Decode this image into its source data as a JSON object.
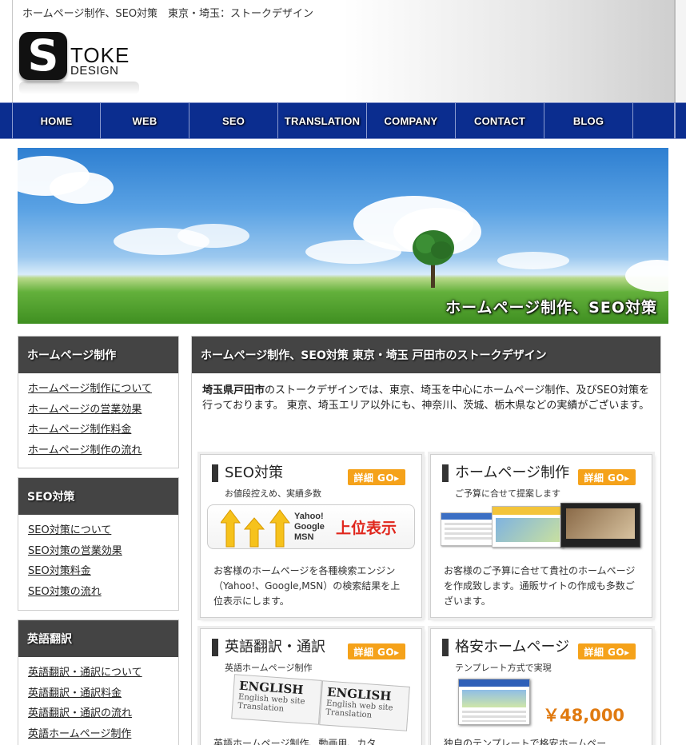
{
  "header": {
    "tagline": "ホームページ制作、SEO対策　東京・埼玉：ストークデザイン",
    "logo_letter": "S",
    "logo_word": "TOKE",
    "logo_sub": "DESIGN"
  },
  "nav": {
    "items": [
      "HOME",
      "WEB",
      "SEO",
      "TRANSLATION",
      "COMPANY",
      "CONTACT",
      "BLOG"
    ]
  },
  "hero": {
    "caption": "ホームページ制作、SEO対策"
  },
  "sidebar": {
    "sections": [
      {
        "title": "ホームページ制作",
        "links": [
          "ホームページ制作について",
          "ホームページの営業効果",
          "ホームページ制作料金",
          "ホームページ制作の流れ"
        ]
      },
      {
        "title": "SEO対策",
        "links": [
          "SEO対策について",
          "SEO対策の営業効果",
          "SEO対策料金",
          "SEO対策の流れ"
        ]
      },
      {
        "title": "英語翻訳",
        "links": [
          "英語翻訳・通訳について",
          "英語翻訳・通訳料金",
          "英語翻訳・通訳の流れ",
          "英語ホームページ制作"
        ]
      }
    ]
  },
  "main": {
    "heading": "ホームページ制作、SEO対策 東京・埼玉 戸田市のストークデザイン",
    "intro_bold": "埼玉県戸田市",
    "intro_rest": "のストークデザインでは、東京、埼玉を中心にホームページ制作、及びSEO対策を行っております。 東京、埼玉エリア以外にも、神奈川、茨城、栃木県などの実績がございます。",
    "cards": [
      {
        "title": "SEO対策",
        "subtitle": "お値段控えめ、実績多数",
        "go": "詳細 GO▸",
        "engines": "Yahoo! Google MSN",
        "badge": "上位表示",
        "desc": "お客様のホームページを各種検索エンジン（Yahoo!、Google,MSN）の検索結果を上位表示にします。"
      },
      {
        "title": "ホームページ制作",
        "subtitle": "ご予算に合せて提案します",
        "go": "詳細 GO▸",
        "desc": "お客様のご予算に合せて貴社のホームページを作成致します。通販サイトの作成も多数ございます。"
      },
      {
        "title": "英語翻訳・通訳",
        "subtitle": "英語ホームページ制作",
        "go": "詳細 GO▸",
        "sample_title": "ENGLISH",
        "sample_line1": "English web site",
        "sample_line2": "Translation",
        "desc": "英語ホームページ制作、動画用、カタ"
      },
      {
        "title": "格安ホームページ",
        "subtitle": "テンプレート方式で実現",
        "go": "詳細 GO▸",
        "price": "￥48,000",
        "desc": "独自のテンプレートで格安ホームペー"
      }
    ]
  },
  "colors": {
    "nav_bg": "#0b2d8f",
    "section_head_bg": "#444444",
    "go_button": "#f5a21a",
    "badge_red": "#e0261c"
  }
}
